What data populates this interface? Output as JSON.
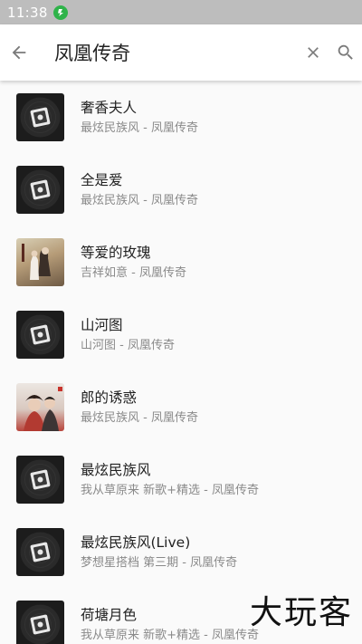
{
  "status_bar": {
    "time": "11:38",
    "app_icon": "green-circle-app-icon"
  },
  "search": {
    "value": "凤凰传奇",
    "back_icon": "arrow-left-icon",
    "clear_icon": "close-icon",
    "search_icon": "search-icon"
  },
  "results": [
    {
      "title": "奢香夫人",
      "subtitle": "最炫民族风 - 凤凰传奇",
      "art": "default"
    },
    {
      "title": "全是爱",
      "subtitle": "最炫民族风 - 凤凰传奇",
      "art": "default"
    },
    {
      "title": "等爱的玫瑰",
      "subtitle": "吉祥如意 - 凤凰传奇",
      "art": "art-a"
    },
    {
      "title": "山河图",
      "subtitle": "山河图 - 凤凰传奇",
      "art": "default"
    },
    {
      "title": "郎的诱惑",
      "subtitle": "最炫民族风 - 凤凰传奇",
      "art": "art-b"
    },
    {
      "title": "最炫民族风",
      "subtitle": "我从草原来 新歌+精选 - 凤凰传奇",
      "art": "default"
    },
    {
      "title": "最炫民族风(Live)",
      "subtitle": "梦想星搭档 第三期 - 凤凰传奇",
      "art": "default"
    },
    {
      "title": "荷塘月色",
      "subtitle": "我从草原来 新歌+精选 - 凤凰传奇",
      "art": "default"
    }
  ],
  "watermark": "大玩客",
  "colors": {
    "status_bar": "#bdbdbd",
    "app_bar": "#ffffff",
    "title_text": "#222222",
    "subtitle_text": "#8a8a8a"
  }
}
